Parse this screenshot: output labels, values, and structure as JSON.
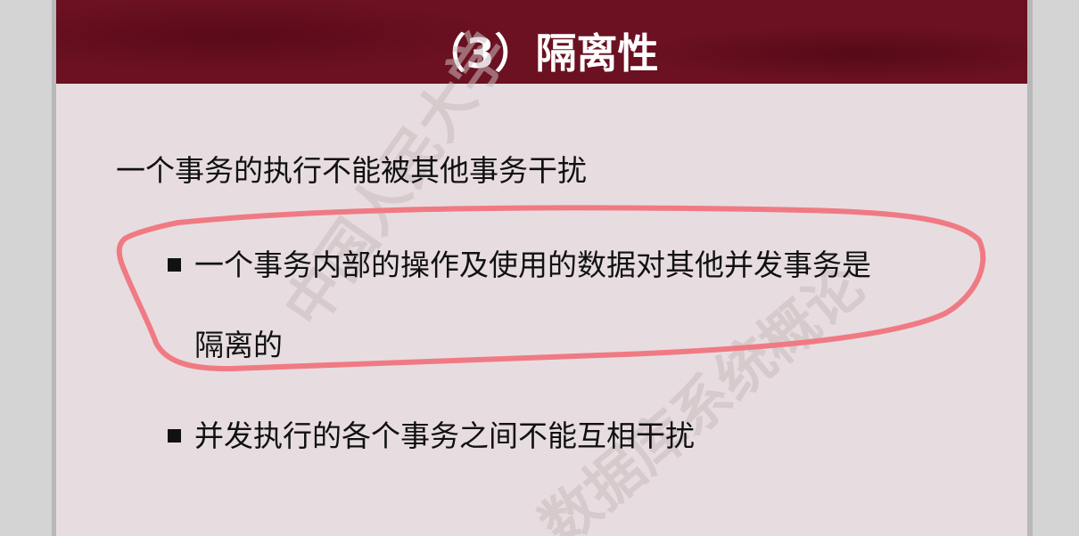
{
  "slide": {
    "title": "（3）隔离性",
    "heading": "一个事务的执行不能被其他事务干扰",
    "bullets": [
      {
        "line1": "一个事务内部的操作及使用的数据对其他并发事务是",
        "line2": "隔离的"
      },
      {
        "line1": "并发执行的各个事务之间不能互相干扰"
      }
    ],
    "watermark": [
      "中国人民大学",
      "数据库系统概论"
    ],
    "colors": {
      "header": "#6b1121",
      "background": "#e7dde0",
      "annotation": "#f07a84"
    }
  }
}
